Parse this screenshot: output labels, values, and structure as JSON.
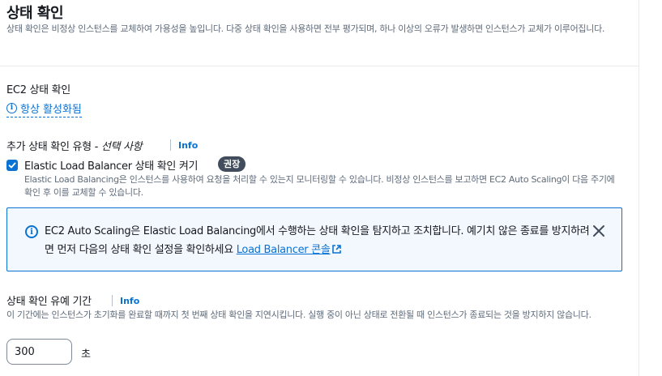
{
  "header": {
    "title": "상태 확인",
    "description": "상태 확인은 비정상 인스턴스를 교체하여 가용성을 높입니다. 다중 상태 확인을 사용하면 전부 평가되며, 하나 이상의 오류가 발생하면 인스턴스가 교체가 이루어집니다."
  },
  "ec2_check": {
    "label": "EC2 상태 확인",
    "status_link": "항상 활성화됨"
  },
  "additional_types": {
    "label": "추가 상태 확인 유형",
    "optional": " - 선택 사항",
    "info": "Info"
  },
  "elb_check": {
    "checked": true,
    "label": "Elastic Load Balancer 상태 확인 켜기",
    "badge": "권장",
    "description": "Elastic Load Balancing은 인스턴스를 사용하여 요청을 처리할 수 있는지 모니터링할 수 있습니다. 비정상 인스턴스를 보고하면 EC2 Auto Scaling이 다음 주기에 확인 후 이를 교체할 수 있습니다."
  },
  "alert": {
    "text": "EC2 Auto Scaling은 Elastic Load Balancing에서 수행하는 상태 확인을 탐지하고 조치합니다. 예기치 않은 종료를 방지하려면 먼저 다음의 상태 확인 설정을 확인하세요 ",
    "link": "Load Balancer 콘솔"
  },
  "grace_period": {
    "label": "상태 확인 유예 기간",
    "info": "Info",
    "description": "이 기간에는 인스턴스가 초기화를 완료할 때까지 첫 번째 상태 확인을 지연시킵니다. 실행 중이 아닌 상태로 전환될 때 인스턴스가 종료되는 것을 방지하지 않습니다.",
    "value": "300",
    "unit": "초"
  },
  "colors": {
    "link": "#0972d3",
    "badge_bg": "#414d5c",
    "alert_bg": "#f2f8fd"
  }
}
